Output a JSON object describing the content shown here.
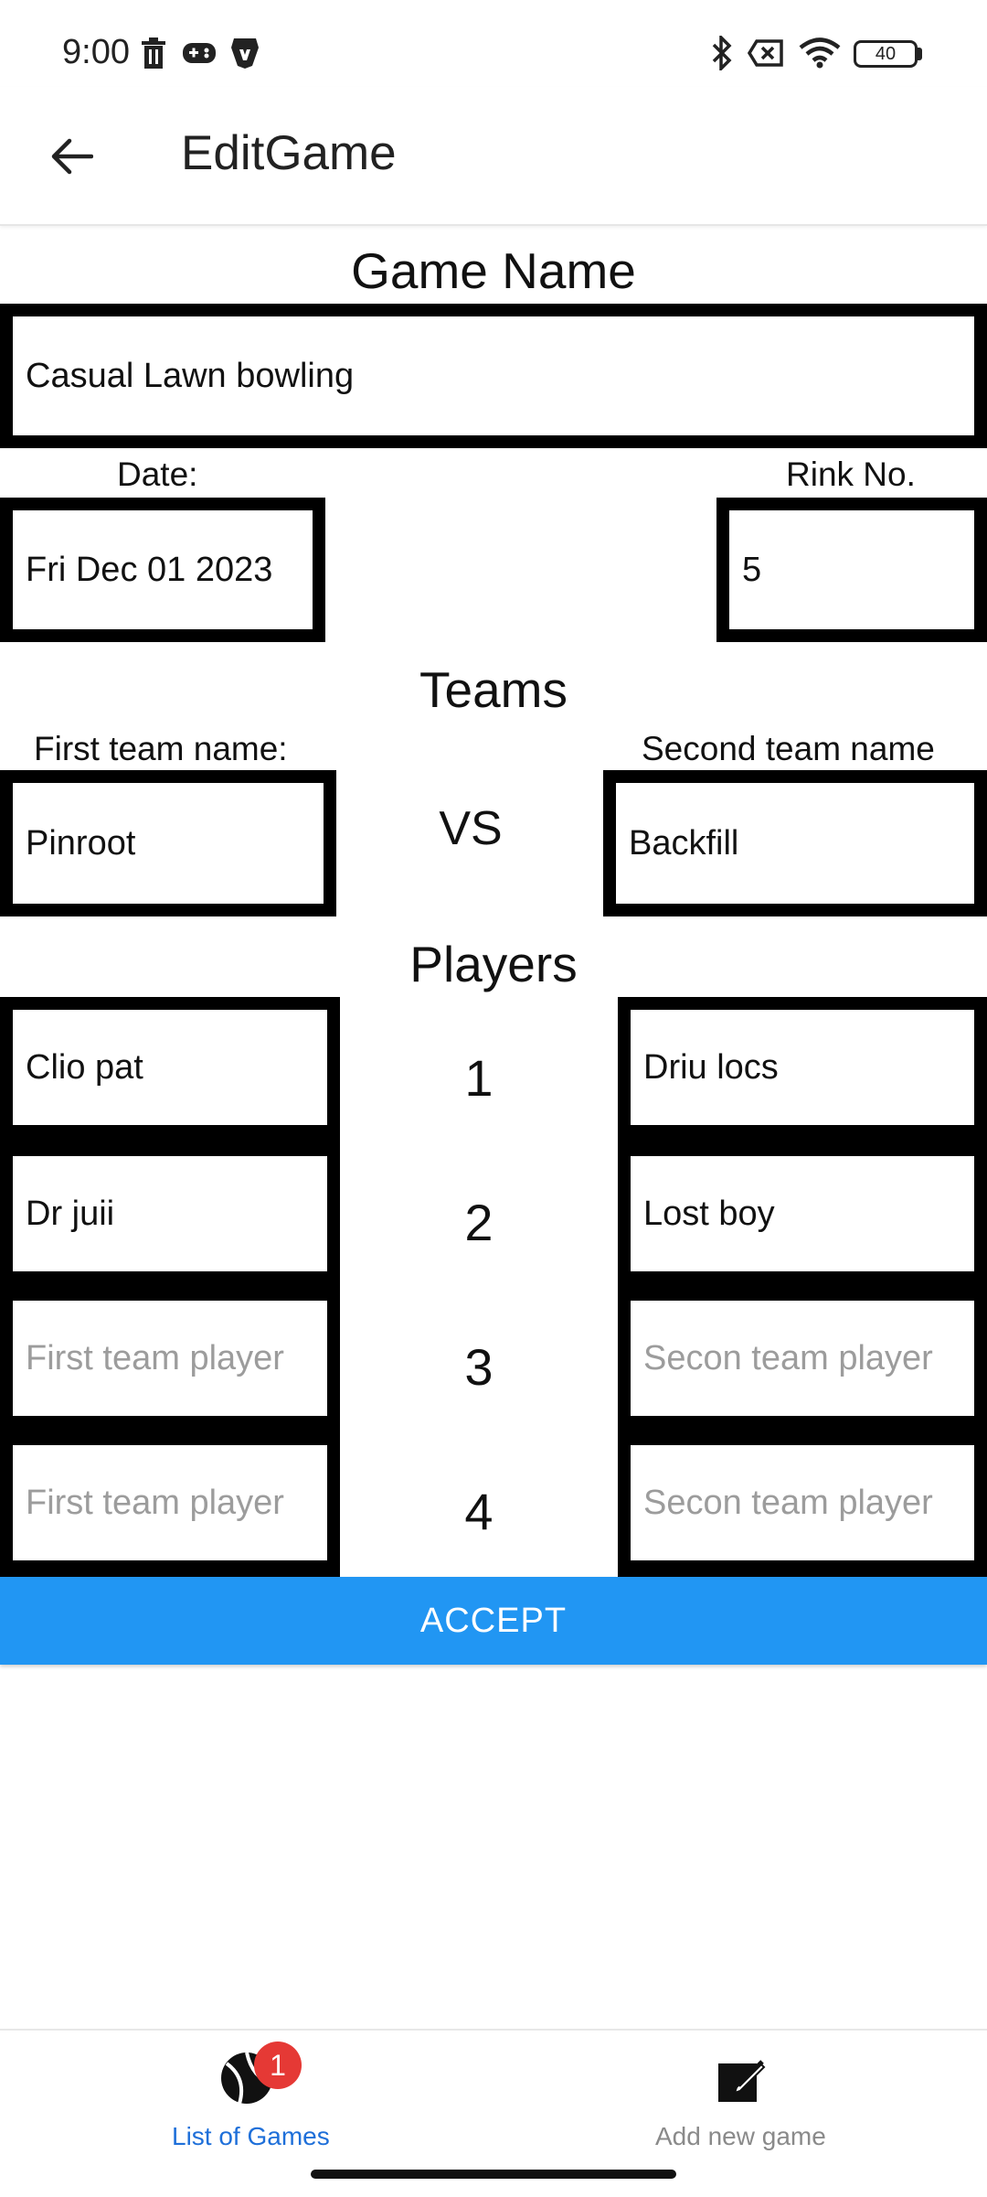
{
  "status_bar": {
    "time": "9:00",
    "battery": "40",
    "icons": [
      "trash-icon",
      "gamepad-icon",
      "brave-lion-icon",
      "bluetooth-icon",
      "no-sim-icon",
      "wifi-icon",
      "battery-icon"
    ]
  },
  "app_bar": {
    "title": "EditGame",
    "back_icon": "arrow-left-icon"
  },
  "form": {
    "game_name_heading": "Game Name",
    "game_name_value": "Casual Lawn bowling",
    "date_label": "Date:",
    "date_value": "Fri Dec 01 2023",
    "rink_label": "Rink No.",
    "rink_value": "5",
    "teams_heading": "Teams",
    "first_team_label": "First team name:",
    "first_team_value": "Pinroot",
    "vs_text": "VS",
    "second_team_label": "Second team name",
    "second_team_value": "Backfill",
    "players_heading": "Players",
    "players": [
      {
        "number": "1",
        "first": "Clio pat",
        "second": "Driu locs",
        "first_placeholder": "",
        "second_placeholder": ""
      },
      {
        "number": "2",
        "first": "Dr juii",
        "second": "Lost boy",
        "first_placeholder": "",
        "second_placeholder": ""
      },
      {
        "number": "3",
        "first": "",
        "second": "",
        "first_placeholder": "First team player",
        "second_placeholder": "Secon team player"
      },
      {
        "number": "4",
        "first": "",
        "second": "",
        "first_placeholder": "First team player",
        "second_placeholder": "Secon team player"
      }
    ],
    "accept_label": "ACCEPT"
  },
  "bottom_nav": {
    "items": [
      {
        "label": "List of Games",
        "icon": "sports-ball-icon",
        "badge": "1",
        "active": true
      },
      {
        "label": "Add new game",
        "icon": "edit-square-icon",
        "active": false
      }
    ]
  },
  "colors": {
    "accent": "#2196f3",
    "active_nav": "#1e6fd9",
    "inactive_nav": "#8a8a8a",
    "badge": "#e53935",
    "placeholder": "#9c9c9c"
  }
}
